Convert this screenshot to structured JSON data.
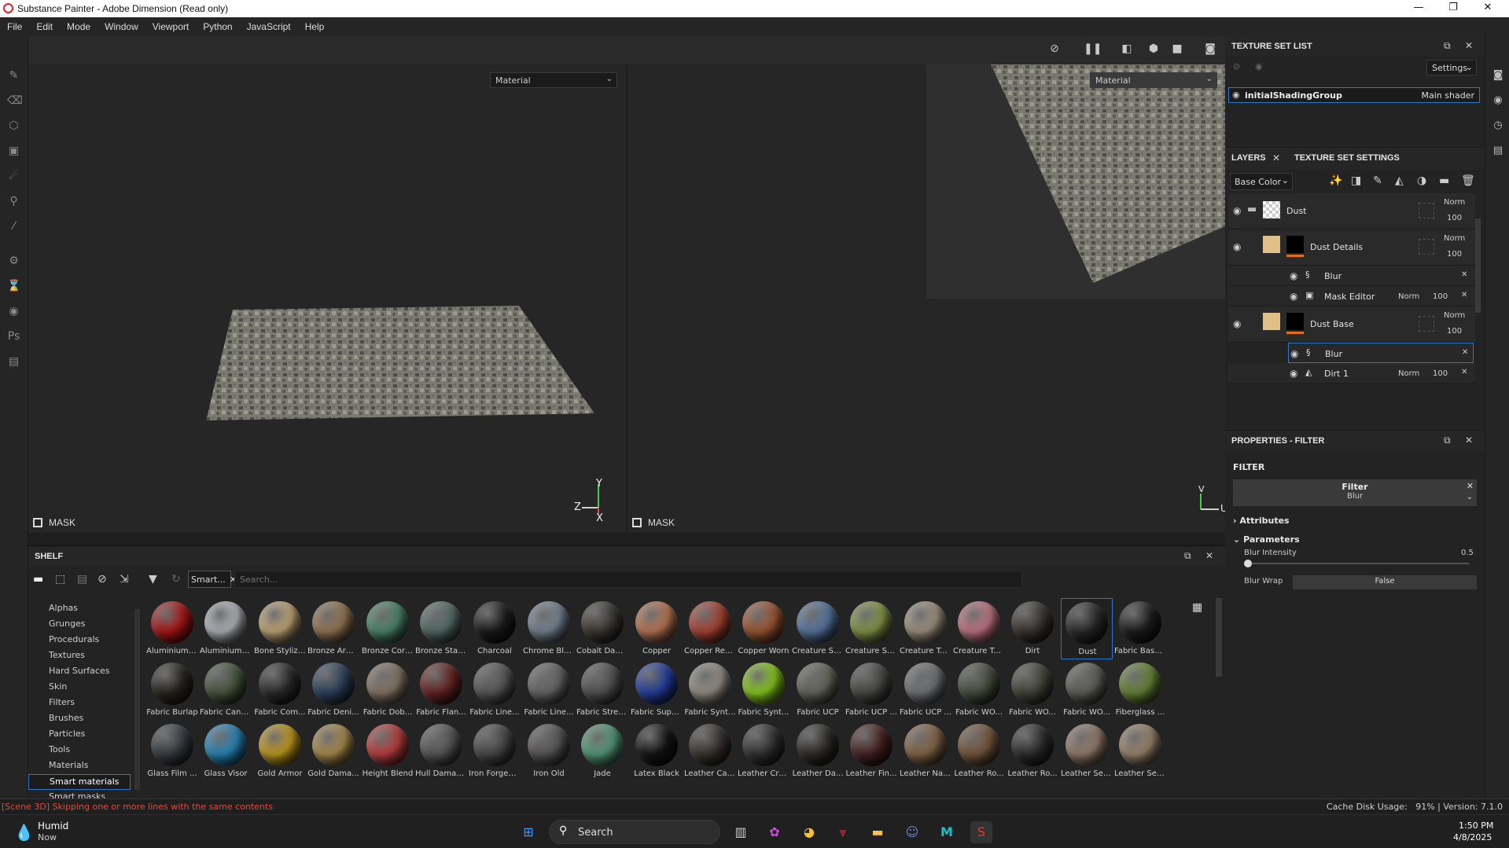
{
  "window": {
    "title": "Substance Painter - Adobe Dimension (Read only)",
    "minimize": "—",
    "maximize": "❐",
    "close": "✕"
  },
  "menu": [
    "File",
    "Edit",
    "Mode",
    "Window",
    "Viewport",
    "Python",
    "JavaScript",
    "Help"
  ],
  "viewport": {
    "left_dropdown": "Material",
    "right_dropdown": "Material",
    "left_mask_label": "MASK",
    "right_mask_label": "MASK",
    "axis_y": "Y",
    "axis_z": "Z",
    "axis_x": "X",
    "uv_v": "V",
    "uv_u": "U"
  },
  "texture_set_list": {
    "title": "TEXTURE SET LIST",
    "settings_label": "Settings",
    "item_name": "initialShadingGroup",
    "item_shader": "Main shader"
  },
  "layers": {
    "tab_layers": "LAYERS",
    "tab_settings": "TEXTURE SET SETTINGS",
    "channel": "Base Color",
    "items": [
      {
        "name": "Dust",
        "blend": "Norm",
        "opacity": "100"
      },
      {
        "name": "Dust Details",
        "blend": "Norm",
        "opacity": "100"
      },
      {
        "name": "Blur"
      },
      {
        "name": "Mask Editor",
        "blend": "Norm",
        "opacity": "100"
      },
      {
        "name": "Dust Base",
        "blend": "Norm",
        "opacity": "100"
      },
      {
        "name": "Blur"
      },
      {
        "name": "Dirt 1",
        "blend": "Norm",
        "opacity": "100"
      }
    ]
  },
  "properties": {
    "title": "PROPERTIES - FILTER",
    "section": "FILTER",
    "filter_label": "Filter",
    "filter_value": "Blur",
    "attributes": "Attributes",
    "parameters": "Parameters",
    "blur_intensity_label": "Blur Intensity",
    "blur_intensity_value": "0.5",
    "blur_wrap_label": "Blur Wrap",
    "blur_wrap_value": "False"
  },
  "shelf": {
    "title": "SHELF",
    "filter_chip": "Smart...",
    "search_placeholder": "Search...",
    "categories": [
      "Alphas",
      "Grunges",
      "Procedurals",
      "Textures",
      "Hard Surfaces",
      "Skin",
      "Filters",
      "Brushes",
      "Particles",
      "Tools",
      "Materials",
      "Smart materials",
      "Smart masks"
    ],
    "selected_category": "Smart materials",
    "materials": [
      {
        "name": "Aluminium ...",
        "color": "#b01818"
      },
      {
        "name": "Aluminium ...",
        "color": "#b8bcc0"
      },
      {
        "name": "Bone Stylized",
        "color": "#c8ad7a"
      },
      {
        "name": "Bronze Arm...",
        "color": "#9a7a55"
      },
      {
        "name": "Bronze Corr...",
        "color": "#4f8a70"
      },
      {
        "name": "Bronze Stat...",
        "color": "#58706a"
      },
      {
        "name": "Charcoal",
        "color": "#1c1c1c"
      },
      {
        "name": "Chrome Blu...",
        "color": "#7a8898"
      },
      {
        "name": "Cobalt Dam...",
        "color": "#3e3a34"
      },
      {
        "name": "Copper",
        "color": "#c07a55"
      },
      {
        "name": "Copper Red...",
        "color": "#b04535"
      },
      {
        "name": "Copper Worn",
        "color": "#a55a35"
      },
      {
        "name": "Creature Ski...",
        "color": "#5a7aa5"
      },
      {
        "name": "Creature Ski...",
        "color": "#8a9a4a"
      },
      {
        "name": "Creature Te...",
        "color": "#a59885"
      },
      {
        "name": "Creature To...",
        "color": "#c87a88"
      },
      {
        "name": "Dirt",
        "color": "#3a3632"
      },
      {
        "name": "Dust",
        "color": "#2a2a2a"
      },
      {
        "name": "Fabric Base...",
        "color": "#1e1e1e"
      },
      {
        "name": "Fabric Burlap",
        "color": "#2a2620"
      },
      {
        "name": "Fabric Canv...",
        "color": "#4a5840"
      },
      {
        "name": "Fabric Com...",
        "color": "#2c2c2c"
      },
      {
        "name": "Fabric Deni...",
        "color": "#2e4460"
      },
      {
        "name": "Fabric Dob...",
        "color": "#8a7a6a"
      },
      {
        "name": "Fabric Flan...",
        "color": "#6a2525"
      },
      {
        "name": "Fabric Line...",
        "color": "#5a5a5a"
      },
      {
        "name": "Fabric Line...",
        "color": "#6a6a6a"
      },
      {
        "name": "Fabric Stret...",
        "color": "#555555"
      },
      {
        "name": "Fabric Supe...",
        "color": "#2440a0"
      },
      {
        "name": "Fabric Synt...",
        "color": "#9a948a"
      },
      {
        "name": "Fabric Synt...",
        "color": "#8cd020"
      },
      {
        "name": "Fabric UCP",
        "color": "#6a6a60"
      },
      {
        "name": "Fabric UCP ...",
        "color": "#4a4a48"
      },
      {
        "name": "Fabric UCP ...",
        "color": "#75787a"
      },
      {
        "name": "Fabric WO...",
        "color": "#4a5040"
      },
      {
        "name": "Fabric WO...",
        "color": "#45483c"
      },
      {
        "name": "Fabric WO...",
        "color": "#60625a"
      },
      {
        "name": "Fiberglass ...",
        "color": "#6a8a3a"
      },
      {
        "name": "Glass Film ...",
        "color": "#3a3f44"
      },
      {
        "name": "Glass Visor",
        "color": "#2a8ac0"
      },
      {
        "name": "Gold Armor",
        "color": "#c8a020"
      },
      {
        "name": "Gold Dama...",
        "color": "#b09050"
      },
      {
        "name": "Height Blend",
        "color": "#c04040"
      },
      {
        "name": "Hull Damag...",
        "color": "#5a5a5a"
      },
      {
        "name": "Iron Forged...",
        "color": "#4a4a4a"
      },
      {
        "name": "Iron Old",
        "color": "#5a5858"
      },
      {
        "name": "Jade",
        "color": "#5aa080"
      },
      {
        "name": "Latex Black",
        "color": "#151515"
      },
      {
        "name": "Leather Calf...",
        "color": "#3a3530"
      },
      {
        "name": "Leather Cre...",
        "color": "#333333"
      },
      {
        "name": "Leather Da...",
        "color": "#2e2c2a"
      },
      {
        "name": "Leather Fin...",
        "color": "#4a2222"
      },
      {
        "name": "Leather Nat...",
        "color": "#8a6a4a"
      },
      {
        "name": "Leather Ro...",
        "color": "#7a5a3e"
      },
      {
        "name": "Leather Ro...",
        "color": "#2e2e2e"
      },
      {
        "name": "Leather Sea...",
        "color": "#9a8070"
      },
      {
        "name": "Leather Sea...",
        "color": "#a08a72"
      }
    ]
  },
  "status": {
    "message": "[Scene 3D] Skipping one or more lines with the same contents",
    "right": "Cache Disk Usage:   91% | Version: 7.1.0"
  },
  "taskbar": {
    "weather_title": "Humid",
    "weather_sub": "Now",
    "search": "Search",
    "time": "1:50 PM",
    "date": "4/8/2025"
  },
  "colors": {
    "accent": "#2b77c8",
    "orange": "#e07020",
    "status_red": "#e04b3b"
  }
}
